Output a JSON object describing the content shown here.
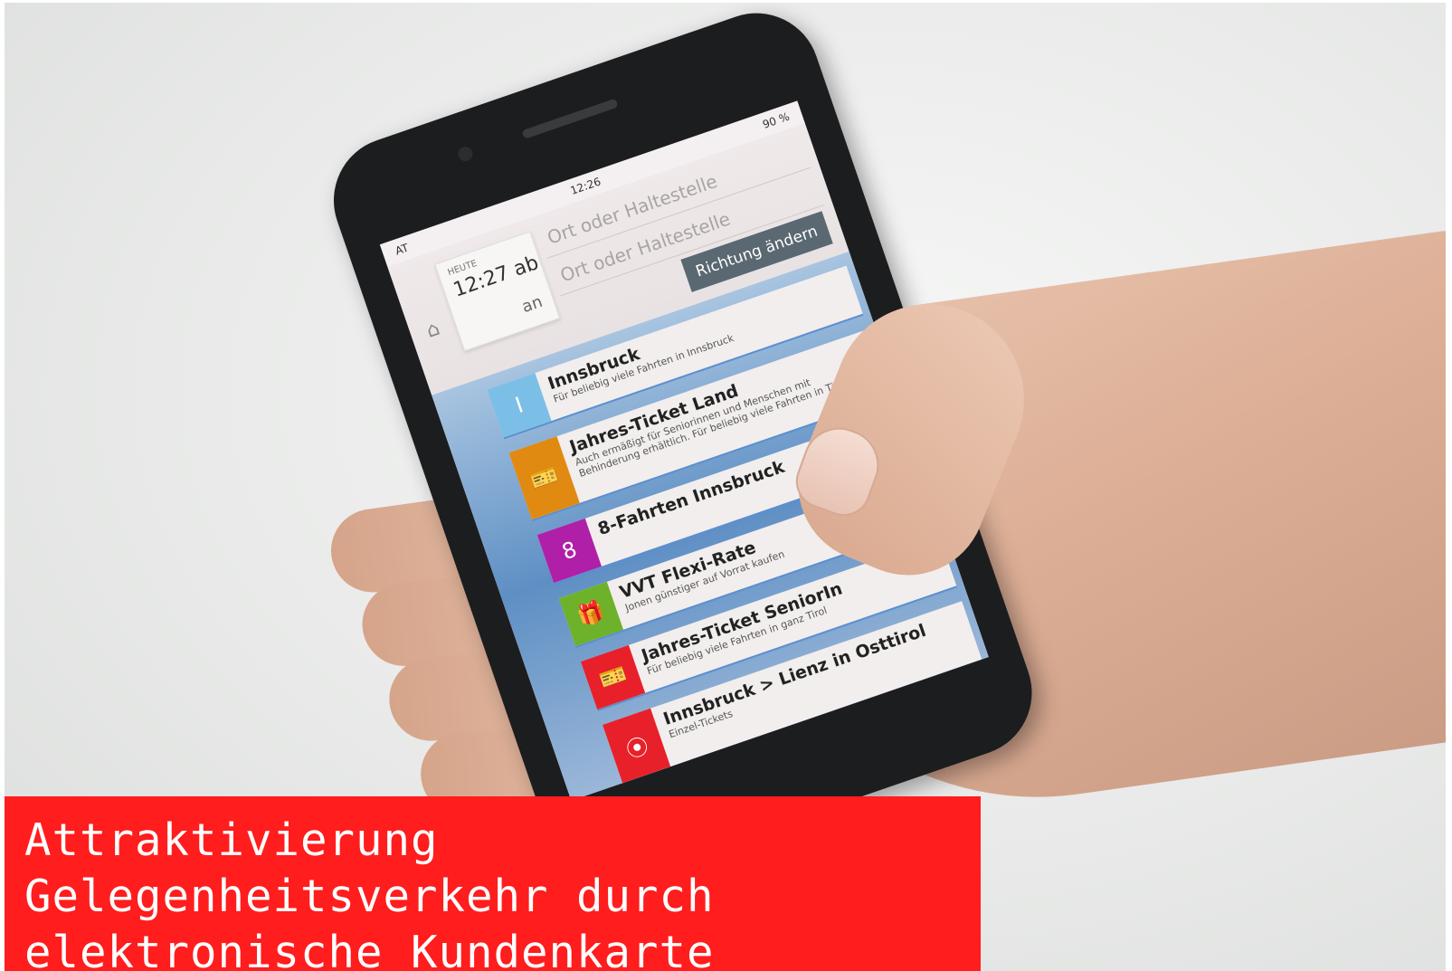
{
  "phone": {
    "status_time": "12:26",
    "status_left": "AT",
    "status_right": "90 %",
    "search": {
      "day_label": "HEUTE",
      "time_departure": "12:27 ab",
      "arrival_label": "an",
      "from_placeholder": "Ort oder Haltestelle",
      "to_placeholder": "Ort oder Haltestelle",
      "swap_button": "Richtung ändern"
    },
    "tickets": [
      {
        "title": "Innsbruck",
        "subtitle": "Für beliebig viele Fahrten in Innsbruck",
        "icon": "I",
        "color": "#7cbfe6"
      },
      {
        "title": "Jahres-Ticket Land",
        "subtitle": "Auch ermäßigt für Seniorinnen und Menschen mit Behinderung erhältlich. Für beliebig viele Fahrten in Tirol",
        "icon": "ticket-icon",
        "color": "#e08a12"
      },
      {
        "title": "8-Fahrten Innsbruck",
        "subtitle": "",
        "icon": "8",
        "color": "#b01fa8"
      },
      {
        "title": "VVT Flexi-Rate",
        "subtitle": "Jonen günstiger auf Vorrat kaufen",
        "icon": "gift-icon",
        "color": "#6db22a"
      },
      {
        "title": "Jahres-Ticket SeniorIn",
        "subtitle": "Für beliebig viele Fahrten in ganz Tirol",
        "icon": "ticket-icon",
        "color": "#e8202a"
      },
      {
        "title": "Innsbruck > Lienz in Osttirol",
        "subtitle": "Einzel-Tickets",
        "icon": "route-icon",
        "color": "#e8202a"
      }
    ]
  },
  "caption": {
    "line1": "Attraktivierung",
    "line2": "Gelegenheitsverkehr durch",
    "line3": "elektronische Kundenkarte"
  }
}
